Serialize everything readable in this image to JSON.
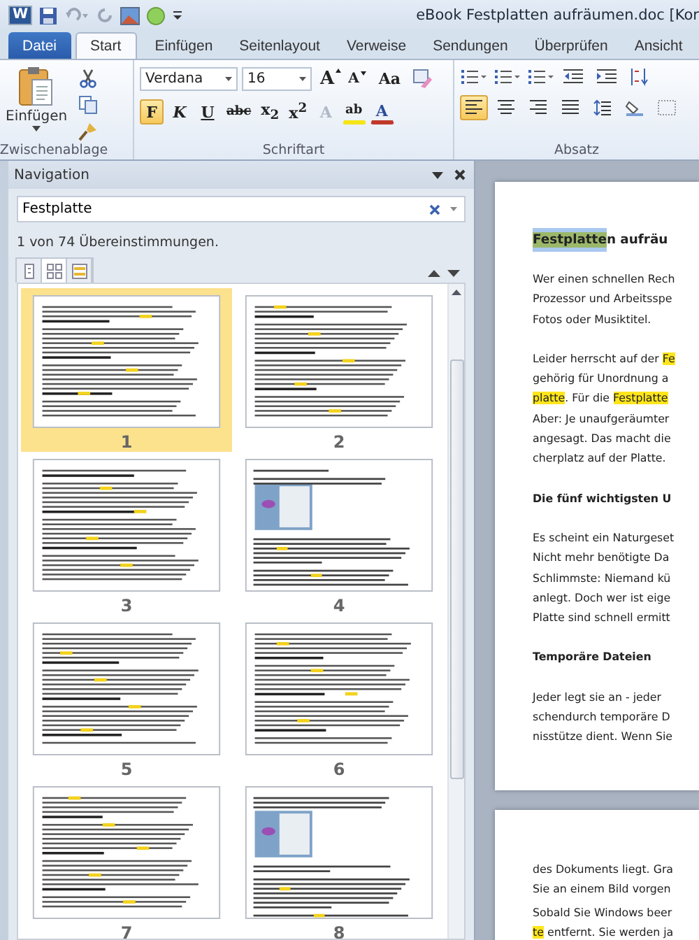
{
  "window": {
    "app_letter": "W",
    "title": "eBook Festplatten aufräumen.doc [Kor"
  },
  "ribbon_tabs": [
    {
      "label": "Datei",
      "kind": "file"
    },
    {
      "label": "Start",
      "kind": "tab",
      "selected": true
    },
    {
      "label": "Einfügen",
      "kind": "tab",
      "selected": false
    },
    {
      "label": "Seitenlayout",
      "kind": "tab",
      "selected": false
    },
    {
      "label": "Verweise",
      "kind": "tab",
      "selected": false
    },
    {
      "label": "Sendungen",
      "kind": "tab",
      "selected": false
    },
    {
      "label": "Überprüfen",
      "kind": "tab",
      "selected": false
    },
    {
      "label": "Ansicht",
      "kind": "tab",
      "selected": false
    }
  ],
  "clipboard": {
    "paste_label": "Einfügen",
    "group_label": "Zwischenablage"
  },
  "font": {
    "name": "Verdana",
    "size": "16",
    "group_label": "Schriftart",
    "row1": [
      {
        "kind": "grow",
        "label": "A"
      },
      {
        "kind": "shrink",
        "label": "A"
      },
      {
        "kind": "case",
        "label": "Aa"
      },
      {
        "kind": "clear"
      }
    ],
    "row2": [
      {
        "kind": "bold",
        "label": "F",
        "selected": true
      },
      {
        "kind": "italic",
        "label": "K",
        "selected": false
      },
      {
        "kind": "underline",
        "label": "U",
        "selected": false
      },
      {
        "kind": "strike",
        "label": "abc",
        "selected": false
      },
      {
        "kind": "script",
        "label": "x$_{2}$",
        "selected": false
      },
      {
        "kind": "script",
        "label": "x$^{2}$",
        "selected": false
      },
      {
        "kind": "effect",
        "label": "A",
        "selected": false
      },
      {
        "kind": "highlight",
        "label": "ab",
        "selected": false
      },
      {
        "kind": "color",
        "label": "A",
        "selected": false
      }
    ]
  },
  "paragraph": {
    "group_label": "Absatz",
    "row1": [
      {
        "kind": "bullets"
      },
      {
        "kind": "numbering"
      },
      {
        "kind": "multilevel"
      },
      {
        "kind": "outdent"
      },
      {
        "kind": "indent"
      },
      {
        "kind": "sort"
      }
    ],
    "row2": [
      {
        "kind": "align-left",
        "selected": true
      },
      {
        "kind": "align-center",
        "selected": false
      },
      {
        "kind": "align-right",
        "selected": false
      },
      {
        "kind": "justify",
        "selected": false
      },
      {
        "kind": "spacing",
        "selected": false
      },
      {
        "kind": "shading",
        "selected": false
      },
      {
        "kind": "borders",
        "selected": false
      }
    ]
  },
  "navigation": {
    "title": "Navigation",
    "search_value": "Festplatte",
    "result_text": "1 von 74 Übereinstimmungen.",
    "views": [
      {
        "kind": "headings",
        "selected": false
      },
      {
        "kind": "pages",
        "selected": true
      },
      {
        "kind": "results",
        "selected": false
      }
    ],
    "pages": [
      {
        "number": "1",
        "kind": "text",
        "selected": true
      },
      {
        "number": "2",
        "kind": "text",
        "selected": false
      },
      {
        "number": "3",
        "kind": "text",
        "selected": false
      },
      {
        "number": "4",
        "kind": "image",
        "selected": false
      },
      {
        "number": "5",
        "kind": "text",
        "selected": false
      },
      {
        "number": "6",
        "kind": "text",
        "selected": false
      },
      {
        "number": "7",
        "kind": "text",
        "selected": false
      },
      {
        "number": "8",
        "kind": "image",
        "selected": false
      }
    ]
  },
  "document_pages": [
    {
      "blocks": [
        {
          "kind": "title",
          "lines": [
            [
              {
                "text": "Festplatte",
                "selected": true
              },
              {
                "text": "n aufräu"
              }
            ]
          ]
        },
        {
          "kind": "text",
          "lines": [
            [
              {
                "text": "Wer einen schnellen Rech"
              }
            ],
            [
              {
                "text": "Prozessor und Arbeitsspe"
              }
            ],
            [
              {
                "text": "Fotos oder Musiktitel."
              }
            ]
          ]
        },
        {
          "kind": "text",
          "lines": [
            [
              {
                "text": "Leider herrscht auf der "
              },
              {
                "text": "Fe",
                "highlighted": true
              }
            ],
            [
              {
                "text": "gehörig für Unordnung a"
              }
            ],
            [
              {
                "text": "platte",
                "highlighted": true
              },
              {
                "text": ". Für die "
              },
              {
                "text": "Festplatte",
                "highlighted": true
              }
            ],
            [
              {
                "text": "Aber: Je unaufgeräumter"
              }
            ],
            [
              {
                "text": "angesagt. Das macht die"
              }
            ],
            [
              {
                "text": "cherplatz auf der Platte."
              }
            ]
          ]
        },
        {
          "kind": "heading",
          "lines": [
            [
              {
                "text": "Die fünf wichtigsten U"
              }
            ]
          ]
        },
        {
          "kind": "text",
          "lines": [
            [
              {
                "text": "Es scheint ein Naturgeset"
              }
            ],
            [
              {
                "text": "Nicht mehr benötigte Da"
              }
            ],
            [
              {
                "text": "Schlimmste: Niemand kü"
              }
            ],
            [
              {
                "text": "anlegt. Doch wer ist eige"
              }
            ],
            [
              {
                "text": "Platte sind schnell ermitt"
              }
            ]
          ]
        },
        {
          "kind": "heading",
          "lines": [
            [
              {
                "text": "Temporäre Dateien"
              }
            ]
          ]
        },
        {
          "kind": "text",
          "lines": [
            [
              {
                "text": "Jeder legt sie an - jeder"
              }
            ],
            [
              {
                "text": "schendurch temporäre D"
              }
            ],
            [
              {
                "text": "nisstütze dient. Wenn Sie"
              }
            ]
          ]
        }
      ]
    },
    {
      "blocks": [
        {
          "kind": "text",
          "lines": [
            [
              {
                "text": "des Dokuments liegt. Gra"
              }
            ],
            [
              {
                "text": "Sie an einem Bild vorgen"
              }
            ]
          ]
        },
        {
          "kind": "text",
          "lines": [
            [
              {
                "text": "Sobald Sie Windows beer"
              }
            ],
            [
              {
                "text": "te",
                "highlighted": true
              },
              {
                "text": " entfernt. Sie werden ja"
              }
            ]
          ]
        }
      ]
    }
  ]
}
